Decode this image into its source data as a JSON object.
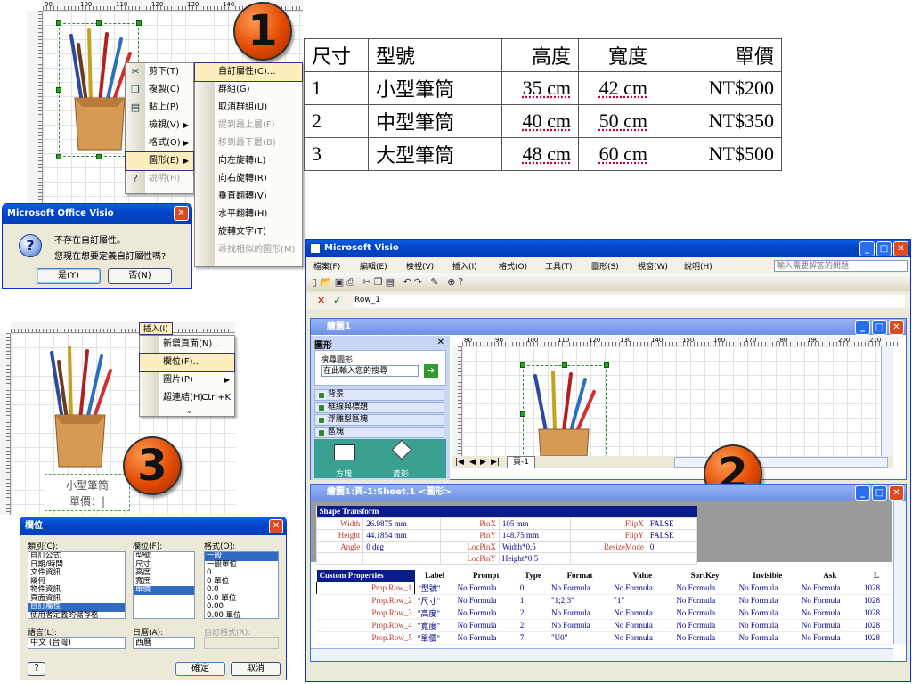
{
  "badges": [
    "1",
    "2",
    "3"
  ],
  "top_rulers": {
    "labels": [
      "90",
      "100",
      "110",
      "120",
      "130",
      "140",
      "150"
    ]
  },
  "context_menu": {
    "items": [
      {
        "label": "剪下(T)",
        "icon": "scissors-icon"
      },
      {
        "label": "複製(C)",
        "icon": "copy-icon"
      },
      {
        "label": "貼上(P)",
        "icon": "paste-icon"
      },
      {
        "label": "檢視(V)",
        "arrow": true
      },
      {
        "label": "格式(O)",
        "arrow": true
      },
      {
        "label": "圖形(E)",
        "arrow": true,
        "highlight": true
      },
      {
        "label": "說明(H)",
        "disabled": true,
        "icon": "help-icon"
      }
    ],
    "submenu": [
      {
        "label": "自訂屬性(C)...",
        "highlight": true
      },
      {
        "label": "群組(G)"
      },
      {
        "label": "取消群組(U)"
      },
      {
        "label": "提到最上層(F)",
        "disabled": true
      },
      {
        "label": "移到最下層(B)",
        "disabled": true
      },
      {
        "label": "向左旋轉(L)"
      },
      {
        "label": "向右旋轉(R)"
      },
      {
        "label": "垂直翻轉(V)"
      },
      {
        "label": "水平翻轉(H)"
      },
      {
        "label": "旋轉文字(T)"
      },
      {
        "label": "尋找相似的圖形(M)",
        "disabled": true
      }
    ]
  },
  "visio_dialog": {
    "title": "Microsoft Office Visio",
    "line1": "不存在自訂屬性。",
    "line2": "您現在想要定義自訂屬性嗎?",
    "yes": "是(Y)",
    "no": "否(N)"
  },
  "data_table": {
    "headers": [
      "尺寸",
      "型號",
      "高度",
      "寬度",
      "單價"
    ],
    "rows": [
      [
        "1",
        "小型筆筒",
        "35 cm",
        "42 cm",
        "NT$200"
      ],
      [
        "2",
        "中型筆筒",
        "40 cm",
        "50 cm",
        "NT$350"
      ],
      [
        "3",
        "大型筆筒",
        "48 cm",
        "60 cm",
        "NT$500"
      ]
    ]
  },
  "insert_menu": {
    "title": "插入(I)",
    "items": [
      {
        "label": "新增頁面(N)..."
      },
      {
        "label": "欄位(F)...",
        "highlight": true
      },
      {
        "label": "圖片(P)",
        "arrow": true
      },
      {
        "label": "超連結(H)...",
        "shortcut": "Ctrl+K"
      }
    ]
  },
  "shape_label": {
    "line1": "小型筆筒",
    "line2": "單價：|"
  },
  "field_dialog": {
    "title": "欄位",
    "category_label": "類別(C):",
    "categories": [
      "自訂公式",
      "日期/時間",
      "文件資訊",
      "幾何",
      "物件資訊",
      "頁面資訊",
      "自訂屬性",
      "使用者定義的儲存格"
    ],
    "category_selected": 6,
    "field_label": "欄位(F):",
    "fields": [
      "型號",
      "尺寸",
      "高度",
      "寬度",
      "單價"
    ],
    "field_selected": 4,
    "format_label": "格式(O):",
    "formats": [
      "一般",
      "一般單位",
      "0",
      "0 單位",
      "0.0",
      "0.0 單位",
      "0.00",
      "0.00 單位"
    ],
    "format_selected": 0,
    "language_label": "語言(L):",
    "language_value": "中文 (台灣)",
    "calendar_label": "日曆(A):",
    "calendar_value": "西曆",
    "custom_format_label": "自訂格式(R):",
    "ok": "確定",
    "cancel": "取消",
    "help": "?"
  },
  "visio_window": {
    "title": "Microsoft Visio",
    "menus": [
      "檔案(F)",
      "編輯(E)",
      "檢視(V)",
      "插入(I)",
      "格式(O)",
      "工具(T)",
      "圖形(S)",
      "視窗(W)",
      "說明(H)"
    ],
    "help_placeholder": "輸入需要解答的問題",
    "formula_value": "Row_1",
    "drawing_title": "繪圖1",
    "shapes_pane": {
      "title": "圖形",
      "search_label": "搜尋圖形:",
      "search_placeholder": "在此輸入您的搜尋",
      "stencils": [
        "背景",
        "框線與標題",
        "浮雕型區塊",
        "區塊"
      ],
      "shape_names": [
        "方塊",
        "菱形"
      ]
    },
    "page_tab": "頁-1",
    "ruler_labels": [
      "80",
      "90",
      "100",
      "110",
      "120",
      "130",
      "140",
      "150",
      "160",
      "170",
      "180",
      "190",
      "200",
      "210"
    ],
    "shapesheet_title": "繪圖1:頁-1:Sheet.1 <圖形>",
    "shape_transform": {
      "header": "Shape Transform",
      "rows": [
        [
          "Width",
          "26.9875 mm",
          "PinX",
          "105 mm",
          "FlipX",
          "FALSE"
        ],
        [
          "Height",
          "44.1854 mm",
          "PinY",
          "148.75 mm",
          "FlipY",
          "FALSE"
        ],
        [
          "Angle",
          "0 deg",
          "LocPinX",
          "Width*0.5",
          "ResizeMode",
          "0"
        ],
        [
          "",
          "",
          "LocPinY",
          "Height*0.5",
          "",
          ""
        ]
      ]
    },
    "custom_props": {
      "headers": [
        "Custom Properties",
        "Label",
        "Prompt",
        "Type",
        "Format",
        "Value",
        "SortKey",
        "Invisible",
        "Ask",
        "L"
      ],
      "rows": [
        [
          "Prop.Row_1",
          "\"型號\"",
          "No Formula",
          "0",
          "No Formula",
          "No Formula",
          "No Formula",
          "No Formula",
          "No Formula",
          "1028"
        ],
        [
          "Prop.Row_2",
          "\"尺寸\"",
          "No Formula",
          "1",
          "\"1;2;3\"",
          "\"1\"",
          "No Formula",
          "No Formula",
          "No Formula",
          "1028"
        ],
        [
          "Prop.Row_3",
          "\"高度\"",
          "No Formula",
          "2",
          "No Formula",
          "No Formula",
          "No Formula",
          "No Formula",
          "No Formula",
          "1028"
        ],
        [
          "Prop.Row_4",
          "\"寬度\"",
          "No Formula",
          "2",
          "No Formula",
          "No Formula",
          "No Formula",
          "No Formula",
          "No Formula",
          "1028"
        ],
        [
          "Prop.Row_5",
          "\"單價\"",
          "No Formula",
          "7",
          "\"U0\"",
          "No Formula",
          "No Formula",
          "No Formula",
          "No Formula",
          "1028"
        ]
      ]
    }
  }
}
